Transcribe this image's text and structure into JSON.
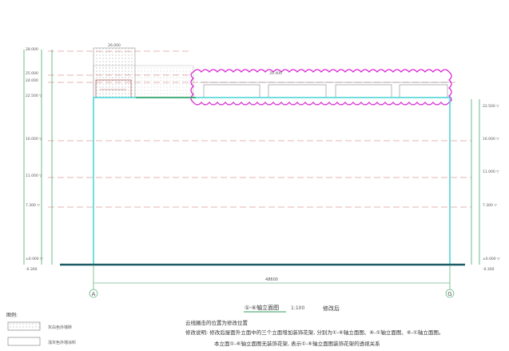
{
  "drawing": {
    "title": "①-⑥轴立面图",
    "scale": "1:100",
    "status": "修改后",
    "total_width_dim": "48600",
    "axis_left": "A",
    "axis_right": "G",
    "dim_roof_span": "20.400",
    "dim_parapet_top": "26.000"
  },
  "left_levels": [
    {
      "label": "28.000"
    },
    {
      "label": "25.000"
    },
    {
      "label": "24.000"
    },
    {
      "label": "22.500 ▽"
    },
    {
      "label": "16.000 ▽"
    },
    {
      "label": "11.000 ▽"
    },
    {
      "label": "7.300 ▽"
    },
    {
      "label": "±0.000 ▽"
    },
    {
      "label": "-0.300"
    }
  ],
  "right_levels": [
    {
      "label": "22.500 ▽"
    },
    {
      "label": "16.000 ▽"
    },
    {
      "label": "11.000 ▽"
    },
    {
      "label": "7.300 ▽"
    },
    {
      "label": "±0.000 ▽"
    },
    {
      "label": "-0.300"
    }
  ],
  "legend": {
    "heading": "图例:",
    "items": [
      {
        "label": "灰白色外墙砖"
      },
      {
        "label": "浅灰色外墙涂料"
      }
    ]
  },
  "notes": {
    "line1": "云线圈击的位置为修改位置",
    "line2": "修改说明: 修改后屋面外立面中的三个立面增加装饰花架, 分别为①-⑥轴立面图、⑥-①轴立面图、⑥-①轴立面图。",
    "line3": "本立面①-⑥轴立面图无装饰花架, 表示①-⑥轴立面图装饰花架的透视关系"
  },
  "colors": {
    "building_outline": "#4fd6d9",
    "revision_cloud": "#d61fd0",
    "dim_lines": "#2e9e5a",
    "level_lines": "#c96a6a",
    "ground": "#1d5a66"
  }
}
